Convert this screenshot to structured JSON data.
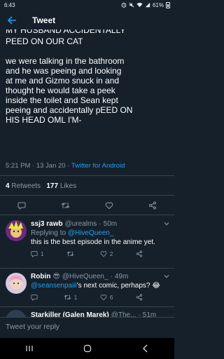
{
  "status_bar": {
    "time": "6:43",
    "icons": [
      "alarm-icon",
      "mute-icon",
      "wifi-icon",
      "signal-icon"
    ],
    "battery": "61%"
  },
  "header": {
    "title": "Tweet"
  },
  "tweet": {
    "partial_top": "MY HUSBAND ACCIDENTALLY",
    "lines": [
      "PEED ON OUR CAT",
      "",
      "we were talking in the bathroom",
      "and he was peeing and looking",
      "at me and Gizmo snuck in and",
      "thought he would take a peek",
      "inside the toilet and Sean kept",
      "peeing and accidentally pEED ON",
      "HIS HEAD OML I'M-"
    ],
    "time": "5:21 PM",
    "date": "13 Jan 20",
    "source": "Twitter for Android",
    "retweets_count": "4",
    "retweets_label": "Retweets",
    "likes_count": "177",
    "likes_label": "Likes"
  },
  "replies": [
    {
      "name": "ssj3 rawb",
      "handle": "@urealms",
      "time": "50m",
      "replying_prefix": "Replying to ",
      "replying_handle": "@HiveQueen_",
      "text": "this is the best episode in the anime yet.",
      "reply_count": "1",
      "retweet_count": "",
      "like_count": "2"
    },
    {
      "name": "Robin",
      "name_emoji": "😎",
      "handle": "@HiveQueen_",
      "time": "49m",
      "mention": "@seansenpaiii",
      "text": "'s next comic, perhaps? 😂",
      "reply_count": "",
      "retweet_count": "1",
      "like_count": "6"
    },
    {
      "name": "Starkiller (Galen Marek)",
      "handle": "@The...",
      "time": "51m"
    }
  ],
  "compose": {
    "placeholder": "Tweet your reply"
  },
  "colors": {
    "background": "#15202b",
    "accent": "#1da1f2",
    "muted": "#8899a6",
    "divider": "#38444d"
  }
}
